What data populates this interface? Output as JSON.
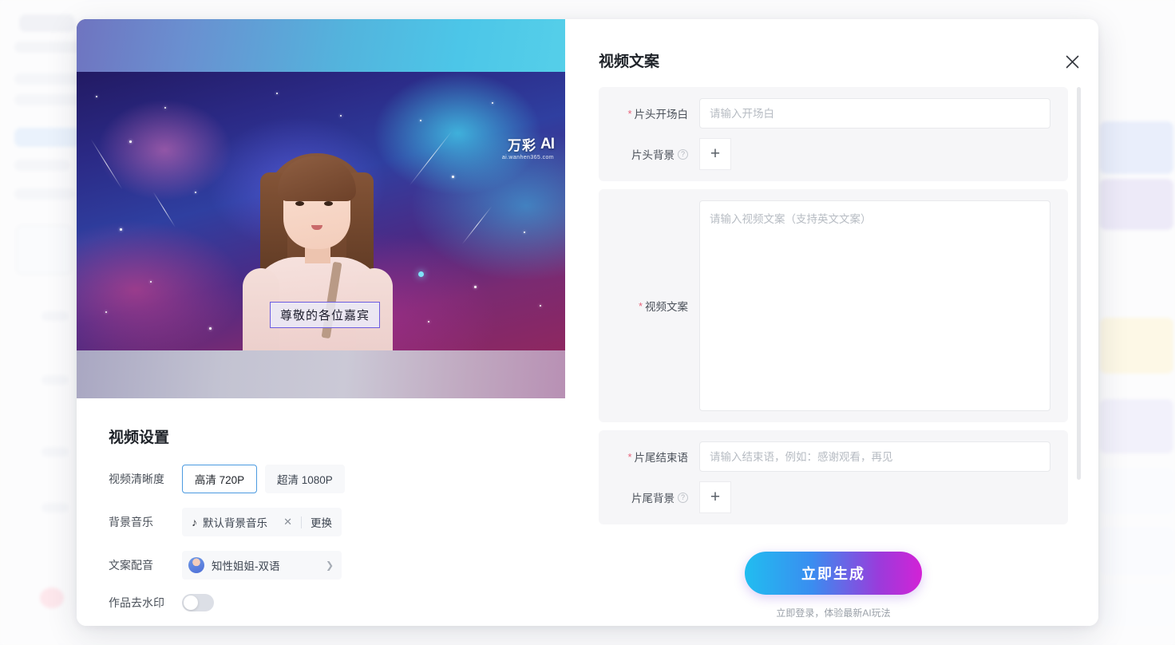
{
  "modal": {
    "close_icon": "close-icon"
  },
  "preview": {
    "caption_text": "尊敬的各位嘉宾",
    "watermark_cn": "万彩",
    "watermark_ai": "AI",
    "watermark_url": "ai.wanhen365.com"
  },
  "settings": {
    "title": "视频设置",
    "resolution": {
      "label": "视频清晰度",
      "options": [
        {
          "label": "高清 720P",
          "selected": true
        },
        {
          "label": "超清 1080P",
          "selected": false
        }
      ]
    },
    "music": {
      "label": "背景音乐",
      "note_icon": "music-note-icon",
      "name": "默认背景音乐",
      "clear_icon": "clear-icon",
      "change_label": "更换"
    },
    "voice": {
      "label": "文案配音",
      "avatar": "voice-avatar",
      "name": "知性姐姐-双语",
      "chevron_icon": "chevron-right-icon"
    },
    "watermark_toggle": {
      "label": "作品去水印",
      "on": false
    }
  },
  "form": {
    "title": "视频文案",
    "opening": {
      "label": "片头开场白",
      "required": true,
      "placeholder": "请输入开场白",
      "value": ""
    },
    "opening_bg": {
      "label": "片头背景",
      "help_icon": "help-icon",
      "add_icon": "plus-icon"
    },
    "script": {
      "label": "视频文案",
      "required": true,
      "placeholder": "请输入视频文案（支持英文文案）",
      "value": ""
    },
    "ending": {
      "label": "片尾结束语",
      "required": true,
      "placeholder": "请输入结束语，例如：感谢观看，再见",
      "value": ""
    },
    "ending_bg": {
      "label": "片尾背景",
      "help_icon": "help-icon",
      "add_icon": "plus-icon"
    }
  },
  "cta": {
    "button_label": "立即生成",
    "subtext": "立即登录，体验最新AI玩法"
  },
  "colors": {
    "accent_blue": "#4b9ae0",
    "required_red": "#e8647c",
    "cta_start": "#21bdf0",
    "cta_end": "#d322d6",
    "card_bg": "#f6f6f8"
  }
}
